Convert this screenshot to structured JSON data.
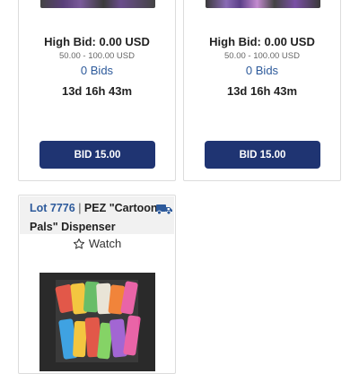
{
  "colors": {
    "primary_button": "#1f3472",
    "link": "#2d5a9b",
    "card_border": "#dcdcdc",
    "lot_header_bg": "#f1f1f1"
  },
  "cards": [
    {
      "high_bid": "High Bid: 0.00 USD",
      "estimate": "50.00 - 100.00 USD",
      "bids": "0 Bids",
      "time_left": "13d 16h 43m",
      "bid_button": "BID 15.00"
    },
    {
      "high_bid": "High Bid: 0.00 USD",
      "estimate": "50.00 - 100.00 USD",
      "bids": "0 Bids",
      "time_left": "13d 16h 43m",
      "bid_button": "BID 15.00"
    }
  ],
  "lot": {
    "number": "Lot 7776",
    "separator": " | ",
    "title_line1": "PEZ \"Cartoon",
    "title_line2": "Pals\" Dispenser",
    "watch": "Watch",
    "shipping_icon": "truck-icon",
    "watch_icon": "star-outline-icon"
  }
}
